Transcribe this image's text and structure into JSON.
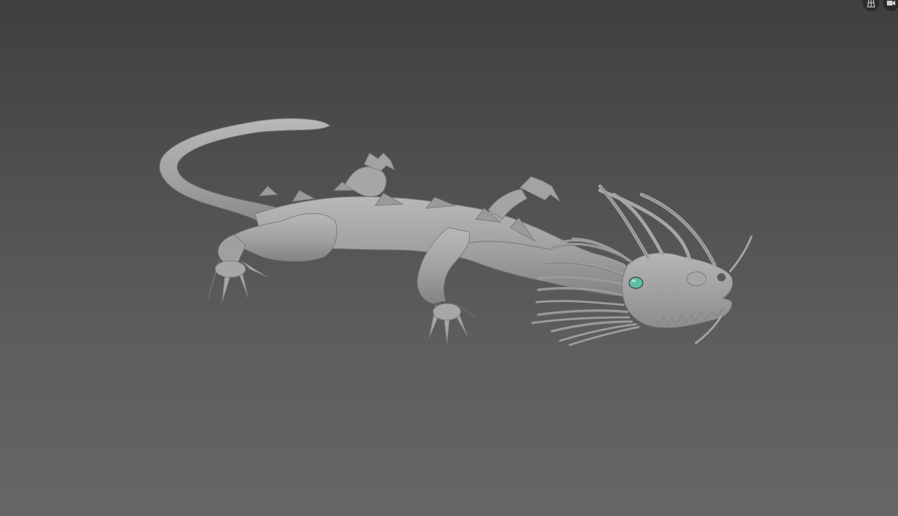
{
  "app": {
    "view": "3D viewport"
  },
  "viewport": {
    "background_top": "#3f3f3f",
    "background_bottom": "#666666",
    "model_color": "#a3a3a3",
    "eye_color": "#5fbfa4"
  },
  "overlay_buttons": [
    {
      "icon": "wireframe-grid-icon"
    },
    {
      "icon": "camera-view-icon"
    }
  ]
}
